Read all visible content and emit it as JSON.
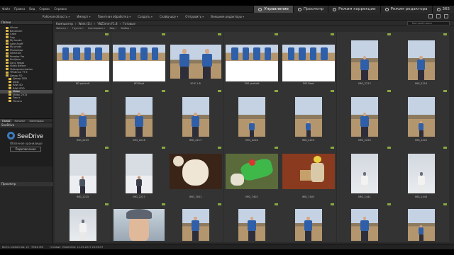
{
  "menu": [
    "Файл",
    "Правка",
    "Вид",
    "Сервис",
    "Справка"
  ],
  "mode_tabs": [
    {
      "label": "Управление",
      "active": true
    },
    {
      "label": "Просмотр",
      "active": false
    },
    {
      "label": "Режим коррекции",
      "active": false
    },
    {
      "label": "Режим редактора",
      "active": false
    },
    {
      "label": "365",
      "active": false
    }
  ],
  "toolbar": {
    "items": [
      "Рабочая область",
      "Импорт",
      "Пакетная обработка",
      "Создать",
      "Слайд-шоу",
      "Отправить",
      "Внешние редакторы"
    ]
  },
  "left_panel": {
    "folders_title": "Папки",
    "tree": [
      "Album",
      "Bandicam",
      "Cake",
      "Fujy",
      "My books",
      "Lake Anaff",
      "My photo",
      "Photoshop",
      "Selection",
      "Premier Pro",
      "Pre4jone",
      "Sony Vegas",
      "Video Before",
      "Videopresentation",
      "TRSDrive TT E",
      "Декор SD",
      "Декор SDD",
      "Nikki",
      "RAW SD",
      "RAW SDD",
      "Video",
      "Video_2015",
      "Текст",
      "Печать"
    ],
    "selected_index": 20,
    "tabs": [
      "Папки",
      "Каталог",
      "Календарь"
    ],
    "seedrive_title": "SeeDrive",
    "seedrive_name": "SeeDrive",
    "seedrive_sub": "Облачное хранилище",
    "seedrive_button": "Подключение",
    "preview_title": "Просмотр"
  },
  "path": [
    "Компьютер",
    "Work (D:)",
    "YNZ5mm F1.8",
    "Готовые"
  ],
  "search_placeholder": "Быстрый поиск",
  "filters": [
    "Фильтр",
    "Группа",
    "Сортировка",
    "Вид",
    "Выбор"
  ],
  "thumbnails": [
    {
      "caption": "6D portrait",
      "kind": "strip"
    },
    {
      "caption": "6D Root",
      "kind": "strip"
    },
    {
      "caption": "50 E 1.8",
      "kind": "pair"
    },
    {
      "caption": "500 portrait",
      "kind": "strip"
    },
    {
      "caption": "500 Root",
      "kind": "strip"
    },
    {
      "caption": "IMG_2213",
      "kind": "man"
    },
    {
      "caption": "IMG_2214",
      "kind": "man"
    },
    {
      "caption": "IMG_2215",
      "kind": "man"
    },
    {
      "caption": "IMG_2216",
      "kind": "man"
    },
    {
      "caption": "IMG_2217",
      "kind": "man"
    },
    {
      "caption": "IMG_2218",
      "kind": "small"
    },
    {
      "caption": "IMG_2219",
      "kind": "small"
    },
    {
      "caption": "IMG_2220",
      "kind": "man"
    },
    {
      "caption": "IMG_2221",
      "kind": "small"
    },
    {
      "caption": "IMG_2225",
      "kind": "winter"
    },
    {
      "caption": "IMG_2227",
      "kind": "winter2"
    },
    {
      "caption": "IMG_7401",
      "kind": "teddy"
    },
    {
      "caption": "IMG_7402",
      "kind": "toy"
    },
    {
      "caption": "IMG_7403",
      "kind": "table"
    },
    {
      "caption": "IMG_1441",
      "kind": "girl"
    },
    {
      "caption": "IMG_1443",
      "kind": "girl"
    },
    {
      "caption": "",
      "kind": "girl"
    },
    {
      "caption": "",
      "kind": "face"
    },
    {
      "caption": "",
      "kind": "man"
    },
    {
      "caption": "",
      "kind": "man"
    },
    {
      "caption": "",
      "kind": "man"
    },
    {
      "caption": "",
      "kind": "man"
    },
    {
      "caption": "",
      "kind": "small"
    }
  ],
  "status": {
    "left": "Всего элементов: 22 · 598.8 МБ",
    "mid": "Готовые",
    "right": "Изменено: 12.03.2017 20:56:57"
  },
  "colors": {
    "jacket": "#2f5fa8",
    "sky": "#c4d2e4",
    "ground": "#b4966e",
    "folder": "#d8b74a",
    "accent": "#8aa83f"
  }
}
